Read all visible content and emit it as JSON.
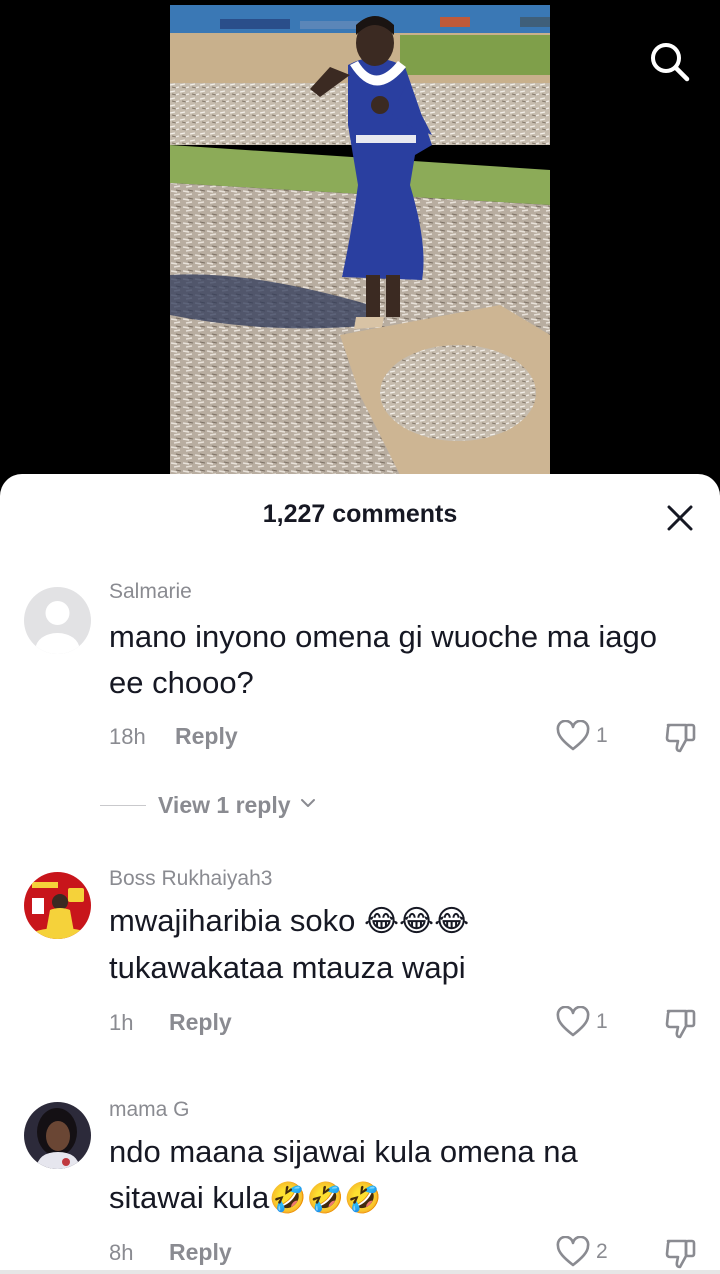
{
  "header": {
    "comments_count": "1,227 comments"
  },
  "icons": {
    "search": "search-icon",
    "close": "close-icon",
    "like": "heart-icon",
    "dislike": "thumbs-down-icon",
    "chevron": "chevron-down-icon"
  },
  "comments": [
    {
      "username": "Salmarie",
      "text": "mano inyono omena gi wuoche ma iago ee chooo?",
      "time": "18h",
      "reply_label": "Reply",
      "likes": "1",
      "view_replies": "View 1 reply"
    },
    {
      "username": "Boss Rukhaiyah3",
      "text": "mwajiharibia soko ",
      "emoji": "😂😂😂",
      "text_cont": "tukawakataa mtauza wapi",
      "time": "1h",
      "reply_label": "Reply",
      "likes": "1"
    },
    {
      "username": "mama G",
      "text": "ndo maana sijawai kula omena na sitawai kula",
      "emoji": "🤣🤣🤣",
      "time": "8h",
      "reply_label": "Reply",
      "likes": "2"
    }
  ],
  "colors": {
    "text_primary": "#161823",
    "text_secondary": "#8a8b91",
    "background_sheet": "#ffffff",
    "background_video": "#000000"
  }
}
